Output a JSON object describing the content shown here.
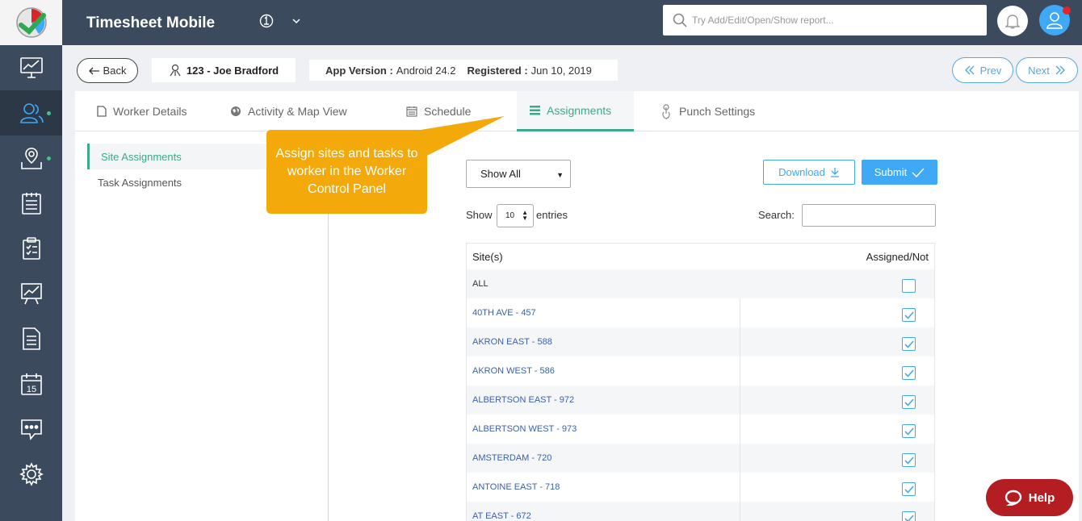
{
  "app": {
    "title": "Timesheet Mobile"
  },
  "search": {
    "placeholder": "Try Add/Edit/Open/Show report..."
  },
  "sidebar": {
    "items": [
      {
        "name": "dashboard",
        "icon": "monitor-chart-icon"
      },
      {
        "name": "workers",
        "icon": "users-icon",
        "active": true,
        "dot": true
      },
      {
        "name": "map",
        "icon": "map-pin-icon",
        "dot": true
      },
      {
        "name": "timesheets",
        "icon": "timesheet-icon"
      },
      {
        "name": "tasks",
        "icon": "clipboard-icon"
      },
      {
        "name": "reports",
        "icon": "presentation-chart-icon"
      },
      {
        "name": "documents",
        "icon": "document-icon"
      },
      {
        "name": "calendar",
        "icon": "calendar-icon",
        "calendar_day": "15"
      },
      {
        "name": "messages",
        "icon": "chat-icon"
      },
      {
        "name": "settings",
        "icon": "gear-icon"
      }
    ]
  },
  "header_info": {
    "back_label": "Back",
    "worker": "123 - Joe Bradford",
    "app_version_label": "App Version :",
    "app_version_value": "Android 24.2",
    "registered_label": "Registered :",
    "registered_value": "Jun 10, 2019",
    "prev_label": "Prev",
    "next_label": "Next"
  },
  "tabs": [
    {
      "label": "Worker Details",
      "icon": "document-icon"
    },
    {
      "label": "Activity & Map View",
      "icon": "globe-icon"
    },
    {
      "label": "Schedule",
      "icon": "calendar-icon"
    },
    {
      "label": "Assignments",
      "icon": "list-icon",
      "active": true
    },
    {
      "label": "Punch Settings",
      "icon": "touch-icon"
    }
  ],
  "subnav": [
    {
      "label": "Site Assignments",
      "active": true
    },
    {
      "label": "Task Assignments"
    }
  ],
  "controls": {
    "filter_value": "Show All",
    "download_label": "Download",
    "submit_label": "Submit",
    "show_label": "Show",
    "entries_value": "10",
    "entries_label": "entries",
    "search_label": "Search:"
  },
  "table": {
    "col_site": "Site(s)",
    "col_assigned": "Assigned/Not",
    "rows": [
      {
        "site": "ALL",
        "assigned": false
      },
      {
        "site": "40TH AVE - 457",
        "assigned": true
      },
      {
        "site": "AKRON EAST - 588",
        "assigned": true
      },
      {
        "site": "AKRON WEST - 586",
        "assigned": true
      },
      {
        "site": "ALBERTSON EAST - 972",
        "assigned": true
      },
      {
        "site": "ALBERTSON WEST - 973",
        "assigned": true
      },
      {
        "site": "AMSTERDAM - 720",
        "assigned": true
      },
      {
        "site": "ANTOINE EAST - 718",
        "assigned": true
      },
      {
        "site": "AT EAST - 672",
        "assigned": true
      }
    ]
  },
  "callout": {
    "text": "Assign sites and tasks to worker in the Worker Control Panel"
  },
  "help": {
    "label": "Help"
  },
  "colors": {
    "sidebar": "#3b4a5c",
    "accent_green": "#3aaa8a",
    "accent_blue": "#3fa9f5",
    "callout": "#f4a90a",
    "help": "#b41e22"
  }
}
